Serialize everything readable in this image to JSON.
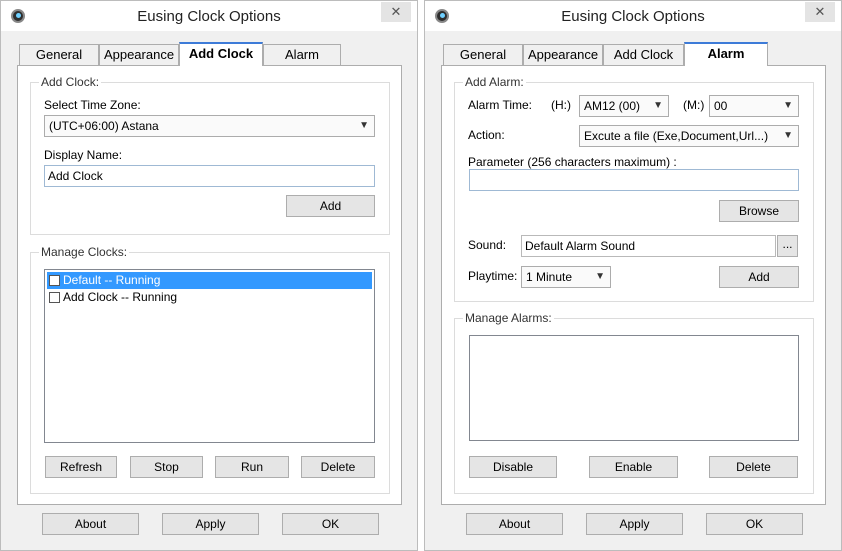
{
  "window_title": "Eusing Clock Options",
  "close_glyph": "✕",
  "app_icon": "clock-app-icon",
  "tabs": [
    "General",
    "Appearance",
    "Add Clock",
    "Alarm"
  ],
  "footer": {
    "about": "About",
    "apply": "Apply",
    "ok": "OK"
  },
  "add_clock_page": {
    "group_label": "Add Clock:",
    "timezone_label": "Select Time Zone:",
    "timezone_value": "(UTC+06:00) Astana",
    "display_name_label": "Display Name:",
    "display_name_value": "Add Clock",
    "add_button": "Add",
    "manage_label": "Manage Clocks:",
    "clocks": [
      {
        "name": "Default -- Running",
        "checked": false,
        "selected": true
      },
      {
        "name": "Add Clock -- Running",
        "checked": false,
        "selected": false
      }
    ],
    "buttons": {
      "refresh": "Refresh",
      "stop": "Stop",
      "run": "Run",
      "delete": "Delete"
    }
  },
  "alarm_page": {
    "group_label": "Add Alarm:",
    "time_label": "Alarm Time:",
    "hour_label": "(H:)",
    "hour_value": "AM12 (00)",
    "minute_label": "(M:)",
    "minute_value": "00",
    "action_label": "Action:",
    "action_value": "Excute a file (Exe,Document,Url...)",
    "parameter_label": "Parameter (256 characters maximum) :",
    "parameter_value": "",
    "browse_button": "Browse",
    "sound_label": "Sound:",
    "sound_value": "Default Alarm Sound",
    "sound_browse": "...",
    "playtime_label": "Playtime:",
    "playtime_value": "1 Minute",
    "add_button": "Add",
    "manage_label": "Manage Alarms:",
    "buttons": {
      "disable": "Disable",
      "enable": "Enable",
      "delete": "Delete"
    }
  }
}
